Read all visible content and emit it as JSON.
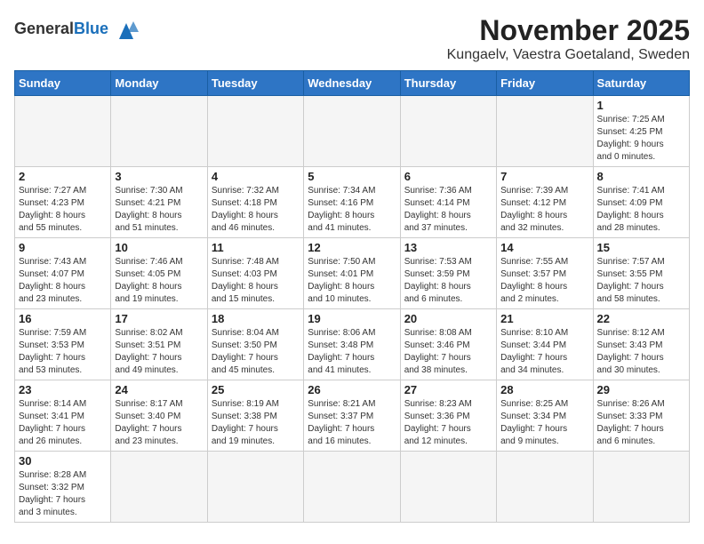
{
  "header": {
    "logo_general": "General",
    "logo_blue": "Blue",
    "main_title": "November 2025",
    "subtitle": "Kungaelv, Vaestra Goetaland, Sweden"
  },
  "calendar": {
    "days_of_week": [
      "Sunday",
      "Monday",
      "Tuesday",
      "Wednesday",
      "Thursday",
      "Friday",
      "Saturday"
    ],
    "weeks": [
      [
        {
          "day": null,
          "info": null
        },
        {
          "day": null,
          "info": null
        },
        {
          "day": null,
          "info": null
        },
        {
          "day": null,
          "info": null
        },
        {
          "day": null,
          "info": null
        },
        {
          "day": null,
          "info": null
        },
        {
          "day": "1",
          "info": "Sunrise: 7:25 AM\nSunset: 4:25 PM\nDaylight: 9 hours\nand 0 minutes."
        }
      ],
      [
        {
          "day": "2",
          "info": "Sunrise: 7:27 AM\nSunset: 4:23 PM\nDaylight: 8 hours\nand 55 minutes."
        },
        {
          "day": "3",
          "info": "Sunrise: 7:30 AM\nSunset: 4:21 PM\nDaylight: 8 hours\nand 51 minutes."
        },
        {
          "day": "4",
          "info": "Sunrise: 7:32 AM\nSunset: 4:18 PM\nDaylight: 8 hours\nand 46 minutes."
        },
        {
          "day": "5",
          "info": "Sunrise: 7:34 AM\nSunset: 4:16 PM\nDaylight: 8 hours\nand 41 minutes."
        },
        {
          "day": "6",
          "info": "Sunrise: 7:36 AM\nSunset: 4:14 PM\nDaylight: 8 hours\nand 37 minutes."
        },
        {
          "day": "7",
          "info": "Sunrise: 7:39 AM\nSunset: 4:12 PM\nDaylight: 8 hours\nand 32 minutes."
        },
        {
          "day": "8",
          "info": "Sunrise: 7:41 AM\nSunset: 4:09 PM\nDaylight: 8 hours\nand 28 minutes."
        }
      ],
      [
        {
          "day": "9",
          "info": "Sunrise: 7:43 AM\nSunset: 4:07 PM\nDaylight: 8 hours\nand 23 minutes."
        },
        {
          "day": "10",
          "info": "Sunrise: 7:46 AM\nSunset: 4:05 PM\nDaylight: 8 hours\nand 19 minutes."
        },
        {
          "day": "11",
          "info": "Sunrise: 7:48 AM\nSunset: 4:03 PM\nDaylight: 8 hours\nand 15 minutes."
        },
        {
          "day": "12",
          "info": "Sunrise: 7:50 AM\nSunset: 4:01 PM\nDaylight: 8 hours\nand 10 minutes."
        },
        {
          "day": "13",
          "info": "Sunrise: 7:53 AM\nSunset: 3:59 PM\nDaylight: 8 hours\nand 6 minutes."
        },
        {
          "day": "14",
          "info": "Sunrise: 7:55 AM\nSunset: 3:57 PM\nDaylight: 8 hours\nand 2 minutes."
        },
        {
          "day": "15",
          "info": "Sunrise: 7:57 AM\nSunset: 3:55 PM\nDaylight: 7 hours\nand 58 minutes."
        }
      ],
      [
        {
          "day": "16",
          "info": "Sunrise: 7:59 AM\nSunset: 3:53 PM\nDaylight: 7 hours\nand 53 minutes."
        },
        {
          "day": "17",
          "info": "Sunrise: 8:02 AM\nSunset: 3:51 PM\nDaylight: 7 hours\nand 49 minutes."
        },
        {
          "day": "18",
          "info": "Sunrise: 8:04 AM\nSunset: 3:50 PM\nDaylight: 7 hours\nand 45 minutes."
        },
        {
          "day": "19",
          "info": "Sunrise: 8:06 AM\nSunset: 3:48 PM\nDaylight: 7 hours\nand 41 minutes."
        },
        {
          "day": "20",
          "info": "Sunrise: 8:08 AM\nSunset: 3:46 PM\nDaylight: 7 hours\nand 38 minutes."
        },
        {
          "day": "21",
          "info": "Sunrise: 8:10 AM\nSunset: 3:44 PM\nDaylight: 7 hours\nand 34 minutes."
        },
        {
          "day": "22",
          "info": "Sunrise: 8:12 AM\nSunset: 3:43 PM\nDaylight: 7 hours\nand 30 minutes."
        }
      ],
      [
        {
          "day": "23",
          "info": "Sunrise: 8:14 AM\nSunset: 3:41 PM\nDaylight: 7 hours\nand 26 minutes."
        },
        {
          "day": "24",
          "info": "Sunrise: 8:17 AM\nSunset: 3:40 PM\nDaylight: 7 hours\nand 23 minutes."
        },
        {
          "day": "25",
          "info": "Sunrise: 8:19 AM\nSunset: 3:38 PM\nDaylight: 7 hours\nand 19 minutes."
        },
        {
          "day": "26",
          "info": "Sunrise: 8:21 AM\nSunset: 3:37 PM\nDaylight: 7 hours\nand 16 minutes."
        },
        {
          "day": "27",
          "info": "Sunrise: 8:23 AM\nSunset: 3:36 PM\nDaylight: 7 hours\nand 12 minutes."
        },
        {
          "day": "28",
          "info": "Sunrise: 8:25 AM\nSunset: 3:34 PM\nDaylight: 7 hours\nand 9 minutes."
        },
        {
          "day": "29",
          "info": "Sunrise: 8:26 AM\nSunset: 3:33 PM\nDaylight: 7 hours\nand 6 minutes."
        }
      ],
      [
        {
          "day": "30",
          "info": "Sunrise: 8:28 AM\nSunset: 3:32 PM\nDaylight: 7 hours\nand 3 minutes."
        },
        {
          "day": null,
          "info": null
        },
        {
          "day": null,
          "info": null
        },
        {
          "day": null,
          "info": null
        },
        {
          "day": null,
          "info": null
        },
        {
          "day": null,
          "info": null
        },
        {
          "day": null,
          "info": null
        }
      ]
    ]
  }
}
